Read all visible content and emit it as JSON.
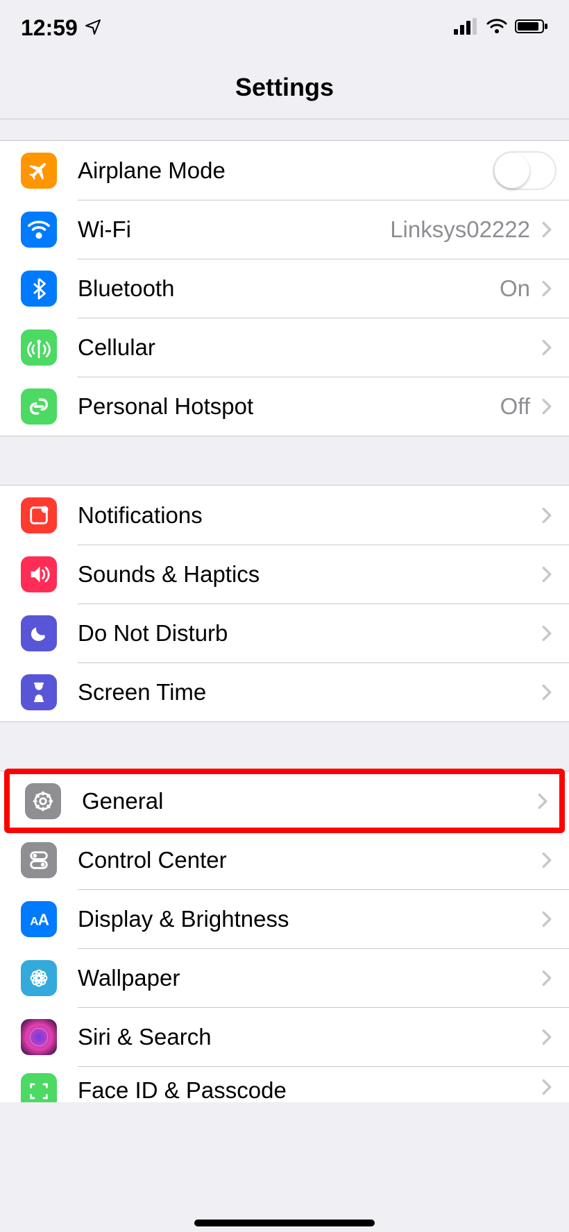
{
  "status_bar": {
    "time": "12:59"
  },
  "nav": {
    "title": "Settings"
  },
  "groups": [
    {
      "rows": [
        {
          "icon": "airplane",
          "color": "orange",
          "label": "Airplane Mode",
          "control": "switch",
          "switch_on": false
        },
        {
          "icon": "wifi",
          "color": "blue",
          "label": "Wi-Fi",
          "detail": "Linksys02222",
          "chevron": true
        },
        {
          "icon": "bluetooth",
          "color": "blue",
          "label": "Bluetooth",
          "detail": "On",
          "chevron": true
        },
        {
          "icon": "cellular",
          "color": "green",
          "label": "Cellular",
          "chevron": true
        },
        {
          "icon": "hotspot",
          "color": "green",
          "label": "Personal Hotspot",
          "detail": "Off",
          "chevron": true
        }
      ]
    },
    {
      "rows": [
        {
          "icon": "notifications",
          "color": "red",
          "label": "Notifications",
          "chevron": true
        },
        {
          "icon": "sounds",
          "color": "pink",
          "label": "Sounds & Haptics",
          "chevron": true
        },
        {
          "icon": "dnd",
          "color": "purple",
          "label": "Do Not Disturb",
          "chevron": true
        },
        {
          "icon": "screentime",
          "color": "purple",
          "label": "Screen Time",
          "chevron": true
        }
      ]
    },
    {
      "rows": [
        {
          "icon": "general",
          "color": "gray",
          "label": "General",
          "chevron": true,
          "highlighted": true
        },
        {
          "icon": "controlcenter",
          "color": "gray",
          "label": "Control Center",
          "chevron": true
        },
        {
          "icon": "display",
          "color": "blue",
          "label": "Display & Brightness",
          "chevron": true
        },
        {
          "icon": "wallpaper",
          "color": "lblue",
          "label": "Wallpaper",
          "chevron": true
        },
        {
          "icon": "siri",
          "color": "siri",
          "label": "Siri & Search",
          "chevron": true
        },
        {
          "icon": "faceid",
          "color": "green2",
          "label": "Face ID & Passcode",
          "chevron": true
        }
      ]
    }
  ]
}
